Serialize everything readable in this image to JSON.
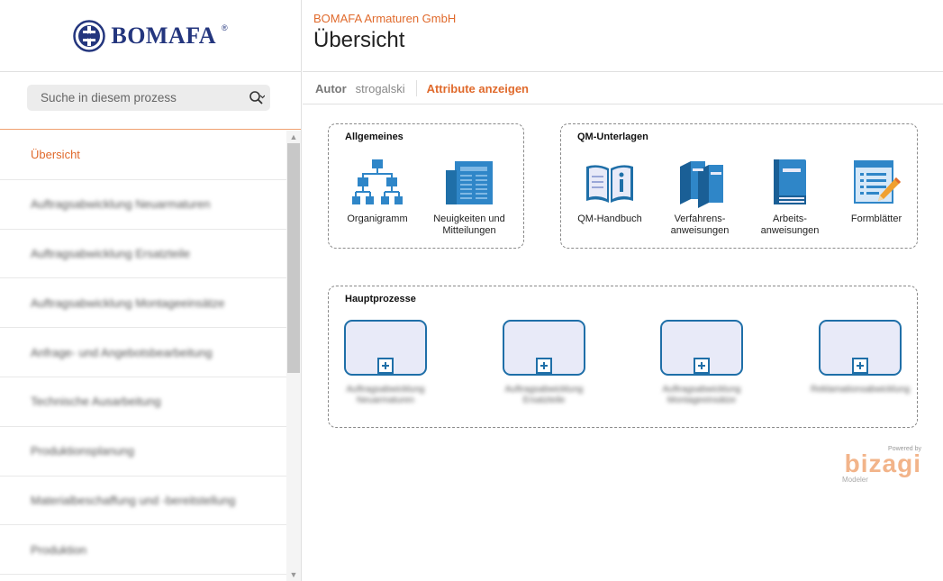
{
  "sidebar": {
    "logo_text": "BOMAFA",
    "logo_reg": "®",
    "search_placeholder": "Suche in diesem prozess",
    "items": [
      {
        "label": "Übersicht",
        "active": true
      },
      {
        "label": "Auftragsabwicklung Neuarmaturen"
      },
      {
        "label": "Auftragsabwicklung Ersatzteile"
      },
      {
        "label": "Auftragsabwicklung Montageeinsätze"
      },
      {
        "label": "Anfrage- und Angebotsbearbeitung"
      },
      {
        "label": "Technische Ausarbeitung"
      },
      {
        "label": "Produktionsplanung"
      },
      {
        "label": "Materialbeschaffung und -bereitstellung"
      },
      {
        "label": "Produktion"
      }
    ]
  },
  "header": {
    "company": "BOMAFA Armaturen GmbH",
    "title": "Übersicht"
  },
  "meta": {
    "author_label": "Autor",
    "author_value": "strogalski",
    "attributes_link": "Attribute anzeigen"
  },
  "panels": {
    "allgemeines": {
      "title": "Allgemeines",
      "tiles": [
        {
          "label": "Organigramm",
          "icon": "org-chart-icon"
        },
        {
          "label": "Neuigkeiten und Mitteilungen",
          "icon": "newspaper-icon"
        }
      ]
    },
    "qm": {
      "title": "QM-Unterlagen",
      "tiles": [
        {
          "label": "QM-Handbuch",
          "icon": "open-book-info-icon"
        },
        {
          "label": "Verfahrens-anweisungen",
          "icon": "books-icon"
        },
        {
          "label": "Arbeits-anweisungen",
          "icon": "binder-icon"
        },
        {
          "label": "Formblätter",
          "icon": "form-pencil-icon"
        }
      ]
    },
    "hauptprozesse": {
      "title": "Hauptprozesse",
      "processes": [
        {
          "label": "Auftragsabwicklung Neuarmaturen"
        },
        {
          "label": "Auftragsabwicklung Ersatzteile"
        },
        {
          "label": "Auftragsabwicklung Montageeinsätze"
        },
        {
          "label": "Reklamationsabwicklung"
        }
      ]
    }
  },
  "branding": {
    "powered_by": "Powered by",
    "name": "bizagi",
    "product": "Modeler"
  },
  "colors": {
    "accent": "#e06a2c",
    "brand_blue": "#24367e",
    "icon_blue": "#2f86c8",
    "process_border": "#1f6fa8"
  }
}
